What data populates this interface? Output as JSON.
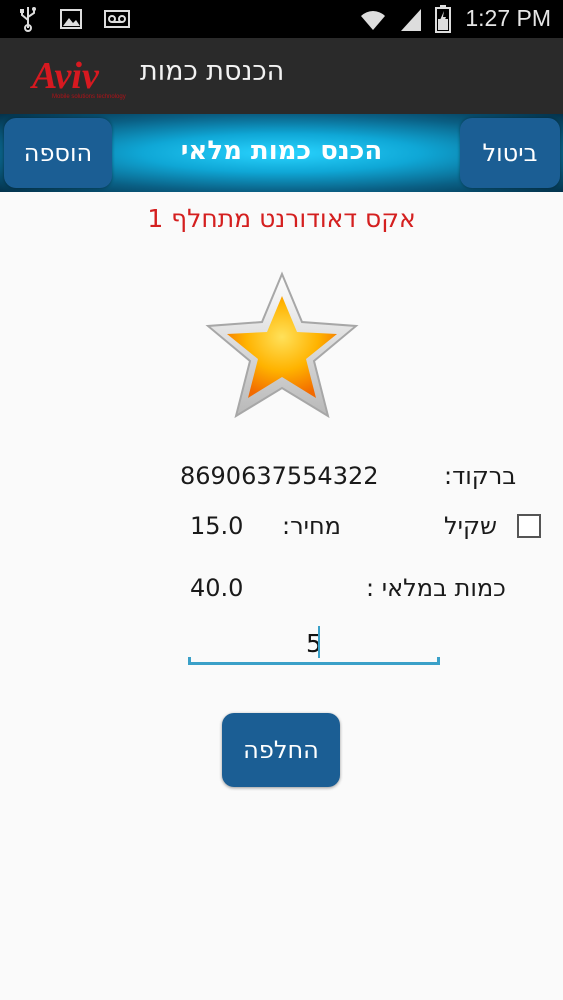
{
  "status_bar": {
    "time": "1:27 PM"
  },
  "app": {
    "title": "הכנסת כמות",
    "logo_text": "Aviv",
    "logo_tagline": "Mobile solutions technology"
  },
  "toolbar": {
    "title": "הכנס כמות מלאי",
    "add_label": "הוספה",
    "cancel_label": "ביטול"
  },
  "product": {
    "name": "אקס דאודורנט מתחלף 1"
  },
  "details": {
    "barcode_label": "ברקוד:",
    "barcode_value": "8690637554322",
    "weighed_label": "שקיל",
    "weighed_checked": false,
    "price_label": "מחיר:",
    "price_value": "15.0",
    "stock_label": "כמות במלאי :",
    "stock_value": "40.0"
  },
  "quantity_input": {
    "value": "5"
  },
  "replace_button": {
    "label": "החלפה"
  },
  "colors": {
    "accent": "#1b5e94",
    "product_name": "#d41f1f",
    "input_line": "#3aa0c8"
  }
}
